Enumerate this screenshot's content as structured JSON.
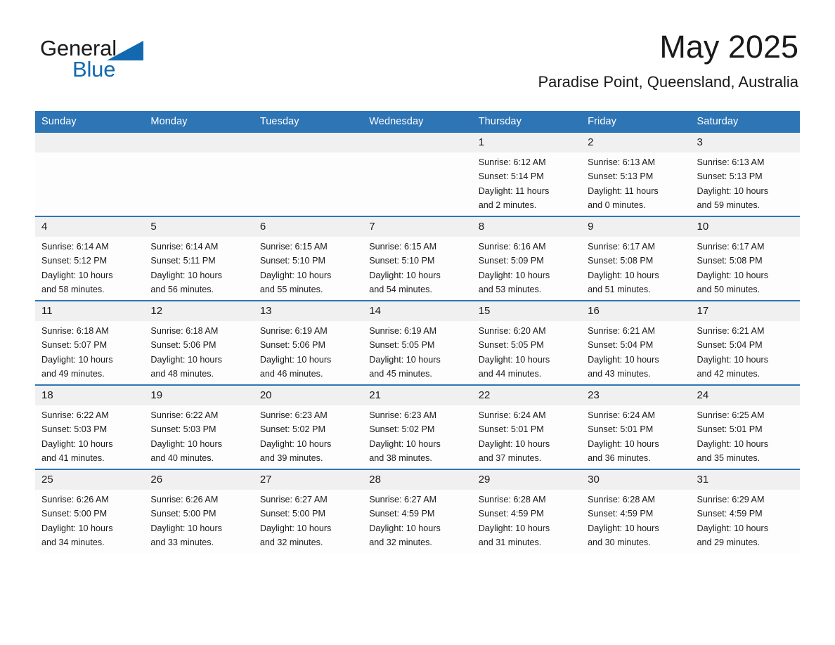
{
  "brand": {
    "name_part1": "General",
    "name_part2": "Blue",
    "accent_color": "#1269b0"
  },
  "header": {
    "month_title": "May 2025",
    "location": "Paradise Point, Queensland, Australia",
    "header_bg_color": "#2e75b6",
    "daynum_bg_color": "#f0f0f0"
  },
  "weekday_headers": [
    "Sunday",
    "Monday",
    "Tuesday",
    "Wednesday",
    "Thursday",
    "Friday",
    "Saturday"
  ],
  "weeks": [
    [
      {
        "day": "",
        "empty": true,
        "sunrise": "",
        "sunset": "",
        "daylight_line1": "",
        "daylight_line2": ""
      },
      {
        "day": "",
        "empty": true,
        "sunrise": "",
        "sunset": "",
        "daylight_line1": "",
        "daylight_line2": ""
      },
      {
        "day": "",
        "empty": true,
        "sunrise": "",
        "sunset": "",
        "daylight_line1": "",
        "daylight_line2": ""
      },
      {
        "day": "",
        "empty": true,
        "sunrise": "",
        "sunset": "",
        "daylight_line1": "",
        "daylight_line2": ""
      },
      {
        "day": "1",
        "empty": false,
        "sunrise": "Sunrise: 6:12 AM",
        "sunset": "Sunset: 5:14 PM",
        "daylight_line1": "Daylight: 11 hours",
        "daylight_line2": "and 2 minutes."
      },
      {
        "day": "2",
        "empty": false,
        "sunrise": "Sunrise: 6:13 AM",
        "sunset": "Sunset: 5:13 PM",
        "daylight_line1": "Daylight: 11 hours",
        "daylight_line2": "and 0 minutes."
      },
      {
        "day": "3",
        "empty": false,
        "sunrise": "Sunrise: 6:13 AM",
        "sunset": "Sunset: 5:13 PM",
        "daylight_line1": "Daylight: 10 hours",
        "daylight_line2": "and 59 minutes."
      }
    ],
    [
      {
        "day": "4",
        "empty": false,
        "sunrise": "Sunrise: 6:14 AM",
        "sunset": "Sunset: 5:12 PM",
        "daylight_line1": "Daylight: 10 hours",
        "daylight_line2": "and 58 minutes."
      },
      {
        "day": "5",
        "empty": false,
        "sunrise": "Sunrise: 6:14 AM",
        "sunset": "Sunset: 5:11 PM",
        "daylight_line1": "Daylight: 10 hours",
        "daylight_line2": "and 56 minutes."
      },
      {
        "day": "6",
        "empty": false,
        "sunrise": "Sunrise: 6:15 AM",
        "sunset": "Sunset: 5:10 PM",
        "daylight_line1": "Daylight: 10 hours",
        "daylight_line2": "and 55 minutes."
      },
      {
        "day": "7",
        "empty": false,
        "sunrise": "Sunrise: 6:15 AM",
        "sunset": "Sunset: 5:10 PM",
        "daylight_line1": "Daylight: 10 hours",
        "daylight_line2": "and 54 minutes."
      },
      {
        "day": "8",
        "empty": false,
        "sunrise": "Sunrise: 6:16 AM",
        "sunset": "Sunset: 5:09 PM",
        "daylight_line1": "Daylight: 10 hours",
        "daylight_line2": "and 53 minutes."
      },
      {
        "day": "9",
        "empty": false,
        "sunrise": "Sunrise: 6:17 AM",
        "sunset": "Sunset: 5:08 PM",
        "daylight_line1": "Daylight: 10 hours",
        "daylight_line2": "and 51 minutes."
      },
      {
        "day": "10",
        "empty": false,
        "sunrise": "Sunrise: 6:17 AM",
        "sunset": "Sunset: 5:08 PM",
        "daylight_line1": "Daylight: 10 hours",
        "daylight_line2": "and 50 minutes."
      }
    ],
    [
      {
        "day": "11",
        "empty": false,
        "sunrise": "Sunrise: 6:18 AM",
        "sunset": "Sunset: 5:07 PM",
        "daylight_line1": "Daylight: 10 hours",
        "daylight_line2": "and 49 minutes."
      },
      {
        "day": "12",
        "empty": false,
        "sunrise": "Sunrise: 6:18 AM",
        "sunset": "Sunset: 5:06 PM",
        "daylight_line1": "Daylight: 10 hours",
        "daylight_line2": "and 48 minutes."
      },
      {
        "day": "13",
        "empty": false,
        "sunrise": "Sunrise: 6:19 AM",
        "sunset": "Sunset: 5:06 PM",
        "daylight_line1": "Daylight: 10 hours",
        "daylight_line2": "and 46 minutes."
      },
      {
        "day": "14",
        "empty": false,
        "sunrise": "Sunrise: 6:19 AM",
        "sunset": "Sunset: 5:05 PM",
        "daylight_line1": "Daylight: 10 hours",
        "daylight_line2": "and 45 minutes."
      },
      {
        "day": "15",
        "empty": false,
        "sunrise": "Sunrise: 6:20 AM",
        "sunset": "Sunset: 5:05 PM",
        "daylight_line1": "Daylight: 10 hours",
        "daylight_line2": "and 44 minutes."
      },
      {
        "day": "16",
        "empty": false,
        "sunrise": "Sunrise: 6:21 AM",
        "sunset": "Sunset: 5:04 PM",
        "daylight_line1": "Daylight: 10 hours",
        "daylight_line2": "and 43 minutes."
      },
      {
        "day": "17",
        "empty": false,
        "sunrise": "Sunrise: 6:21 AM",
        "sunset": "Sunset: 5:04 PM",
        "daylight_line1": "Daylight: 10 hours",
        "daylight_line2": "and 42 minutes."
      }
    ],
    [
      {
        "day": "18",
        "empty": false,
        "sunrise": "Sunrise: 6:22 AM",
        "sunset": "Sunset: 5:03 PM",
        "daylight_line1": "Daylight: 10 hours",
        "daylight_line2": "and 41 minutes."
      },
      {
        "day": "19",
        "empty": false,
        "sunrise": "Sunrise: 6:22 AM",
        "sunset": "Sunset: 5:03 PM",
        "daylight_line1": "Daylight: 10 hours",
        "daylight_line2": "and 40 minutes."
      },
      {
        "day": "20",
        "empty": false,
        "sunrise": "Sunrise: 6:23 AM",
        "sunset": "Sunset: 5:02 PM",
        "daylight_line1": "Daylight: 10 hours",
        "daylight_line2": "and 39 minutes."
      },
      {
        "day": "21",
        "empty": false,
        "sunrise": "Sunrise: 6:23 AM",
        "sunset": "Sunset: 5:02 PM",
        "daylight_line1": "Daylight: 10 hours",
        "daylight_line2": "and 38 minutes."
      },
      {
        "day": "22",
        "empty": false,
        "sunrise": "Sunrise: 6:24 AM",
        "sunset": "Sunset: 5:01 PM",
        "daylight_line1": "Daylight: 10 hours",
        "daylight_line2": "and 37 minutes."
      },
      {
        "day": "23",
        "empty": false,
        "sunrise": "Sunrise: 6:24 AM",
        "sunset": "Sunset: 5:01 PM",
        "daylight_line1": "Daylight: 10 hours",
        "daylight_line2": "and 36 minutes."
      },
      {
        "day": "24",
        "empty": false,
        "sunrise": "Sunrise: 6:25 AM",
        "sunset": "Sunset: 5:01 PM",
        "daylight_line1": "Daylight: 10 hours",
        "daylight_line2": "and 35 minutes."
      }
    ],
    [
      {
        "day": "25",
        "empty": false,
        "sunrise": "Sunrise: 6:26 AM",
        "sunset": "Sunset: 5:00 PM",
        "daylight_line1": "Daylight: 10 hours",
        "daylight_line2": "and 34 minutes."
      },
      {
        "day": "26",
        "empty": false,
        "sunrise": "Sunrise: 6:26 AM",
        "sunset": "Sunset: 5:00 PM",
        "daylight_line1": "Daylight: 10 hours",
        "daylight_line2": "and 33 minutes."
      },
      {
        "day": "27",
        "empty": false,
        "sunrise": "Sunrise: 6:27 AM",
        "sunset": "Sunset: 5:00 PM",
        "daylight_line1": "Daylight: 10 hours",
        "daylight_line2": "and 32 minutes."
      },
      {
        "day": "28",
        "empty": false,
        "sunrise": "Sunrise: 6:27 AM",
        "sunset": "Sunset: 4:59 PM",
        "daylight_line1": "Daylight: 10 hours",
        "daylight_line2": "and 32 minutes."
      },
      {
        "day": "29",
        "empty": false,
        "sunrise": "Sunrise: 6:28 AM",
        "sunset": "Sunset: 4:59 PM",
        "daylight_line1": "Daylight: 10 hours",
        "daylight_line2": "and 31 minutes."
      },
      {
        "day": "30",
        "empty": false,
        "sunrise": "Sunrise: 6:28 AM",
        "sunset": "Sunset: 4:59 PM",
        "daylight_line1": "Daylight: 10 hours",
        "daylight_line2": "and 30 minutes."
      },
      {
        "day": "31",
        "empty": false,
        "sunrise": "Sunrise: 6:29 AM",
        "sunset": "Sunset: 4:59 PM",
        "daylight_line1": "Daylight: 10 hours",
        "daylight_line2": "and 29 minutes."
      }
    ]
  ]
}
